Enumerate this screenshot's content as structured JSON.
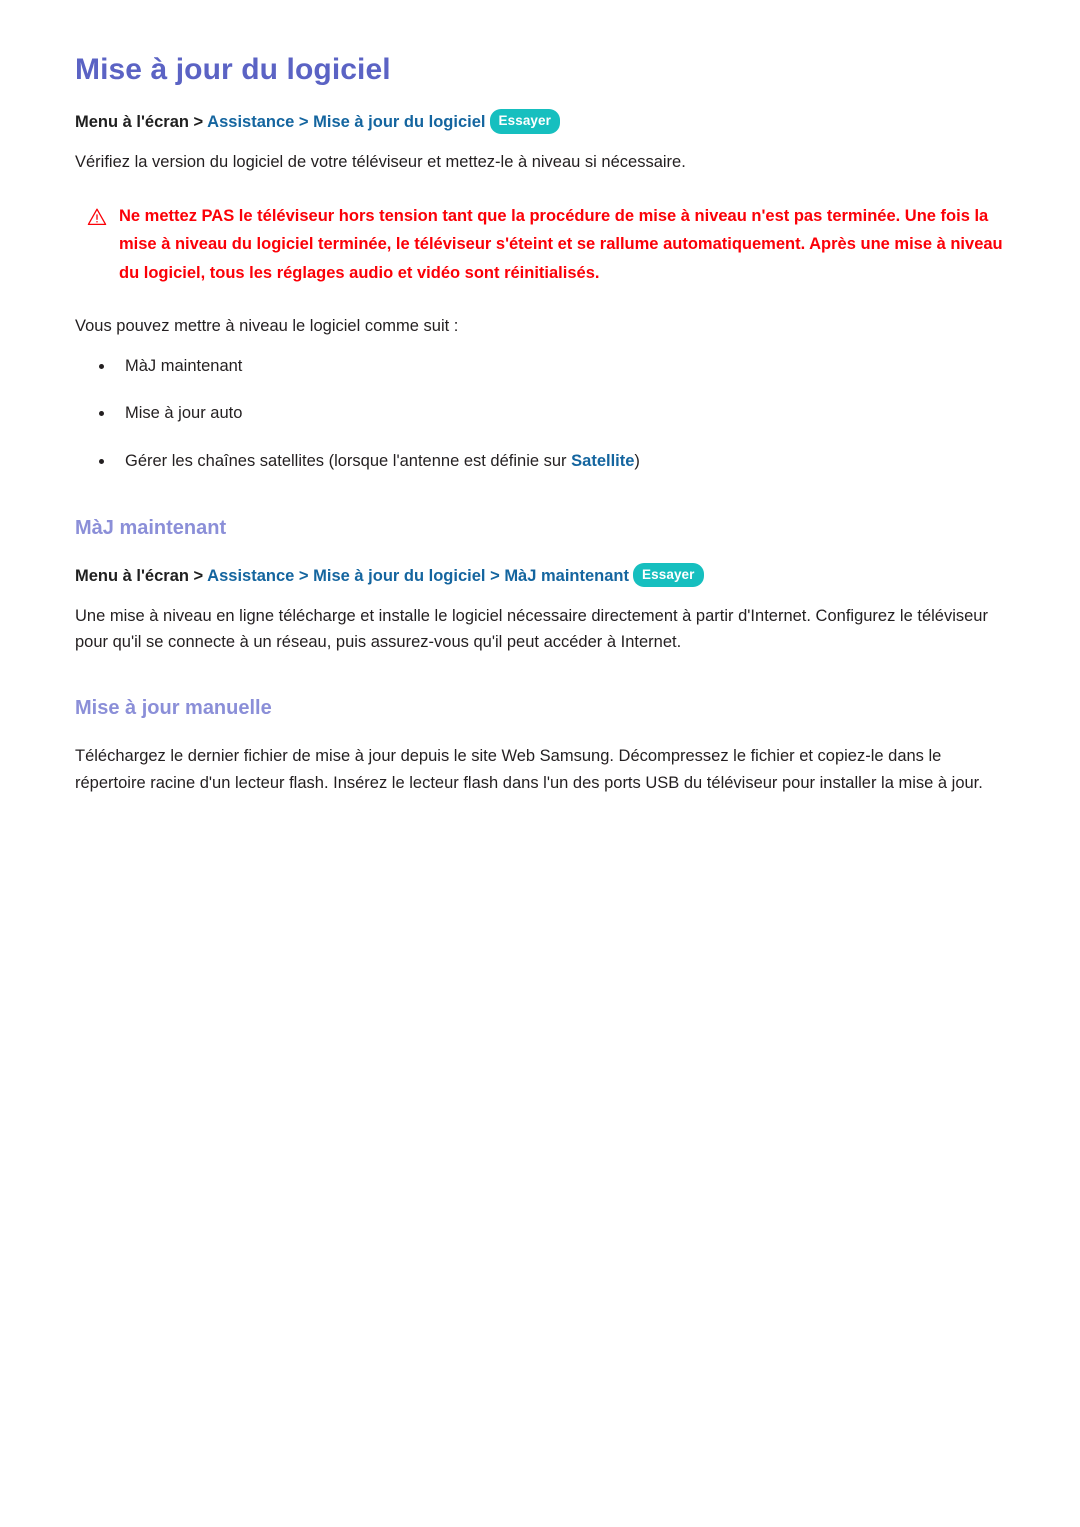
{
  "document": {
    "title": "Mise à jour du logiciel",
    "try_badge_label": "Essayer",
    "warning_icon": "warning-triangle-icon"
  },
  "intro": {
    "breadcrumb": {
      "root": "Menu à l'écran",
      "sep1": " > ",
      "item1": "Assistance",
      "sep2": " > ",
      "item2": "Mise à jour du logiciel",
      "badge": "Essayer"
    },
    "paragraph": "Vérifiez la version du logiciel de votre téléviseur et mettez-le à niveau si nécessaire.",
    "warning": "Ne mettez PAS le téléviseur hors tension tant que la procédure de mise à niveau n'est pas terminée. Une fois la mise à niveau du logiciel terminée, le téléviseur s'éteint et se rallume automatiquement. Après une mise à niveau du logiciel, tous les réglages audio et vidéo sont réinitialisés.",
    "list_intro": "Vous pouvez mettre à niveau le logiciel comme suit :",
    "bullets": [
      {
        "text": "MàJ maintenant"
      },
      {
        "text": "Mise à jour auto"
      },
      {
        "prefix": "Gérer les chaînes satellites (lorsque l'antenne est définie sur ",
        "link": "Satellite",
        "suffix": ")"
      }
    ]
  },
  "section_maj_maintenant": {
    "heading": "MàJ maintenant",
    "breadcrumb": {
      "root": "Menu à l'écran",
      "sep1": " > ",
      "item1": "Assistance",
      "sep2": " > ",
      "item2": "Mise à jour du logiciel",
      "sep3": " > ",
      "item3": "MàJ maintenant",
      "badge": "Essayer"
    },
    "paragraph": "Une mise à niveau en ligne télécharge et installe le logiciel nécessaire directement à partir d'Internet. Configurez le téléviseur pour qu'il se connecte à un réseau, puis assurez-vous qu'il peut accéder à Internet."
  },
  "section_mise_a_jour_manuelle": {
    "heading": "Mise à jour manuelle",
    "paragraph": "Téléchargez le dernier fichier de mise à jour depuis le site Web Samsung. Décompressez le fichier et copiez-le dans le répertoire racine d'un lecteur flash. Insérez le lecteur flash dans l'un des ports USB du téléviseur pour installer la mise à jour."
  },
  "colors": {
    "title_purple": "#5b63c4",
    "heading_purple": "#8b8fd8",
    "link_blue": "#14659f",
    "warning_red": "#fb0007",
    "badge_teal": "#16bfbf",
    "body_text": "#231f20"
  }
}
